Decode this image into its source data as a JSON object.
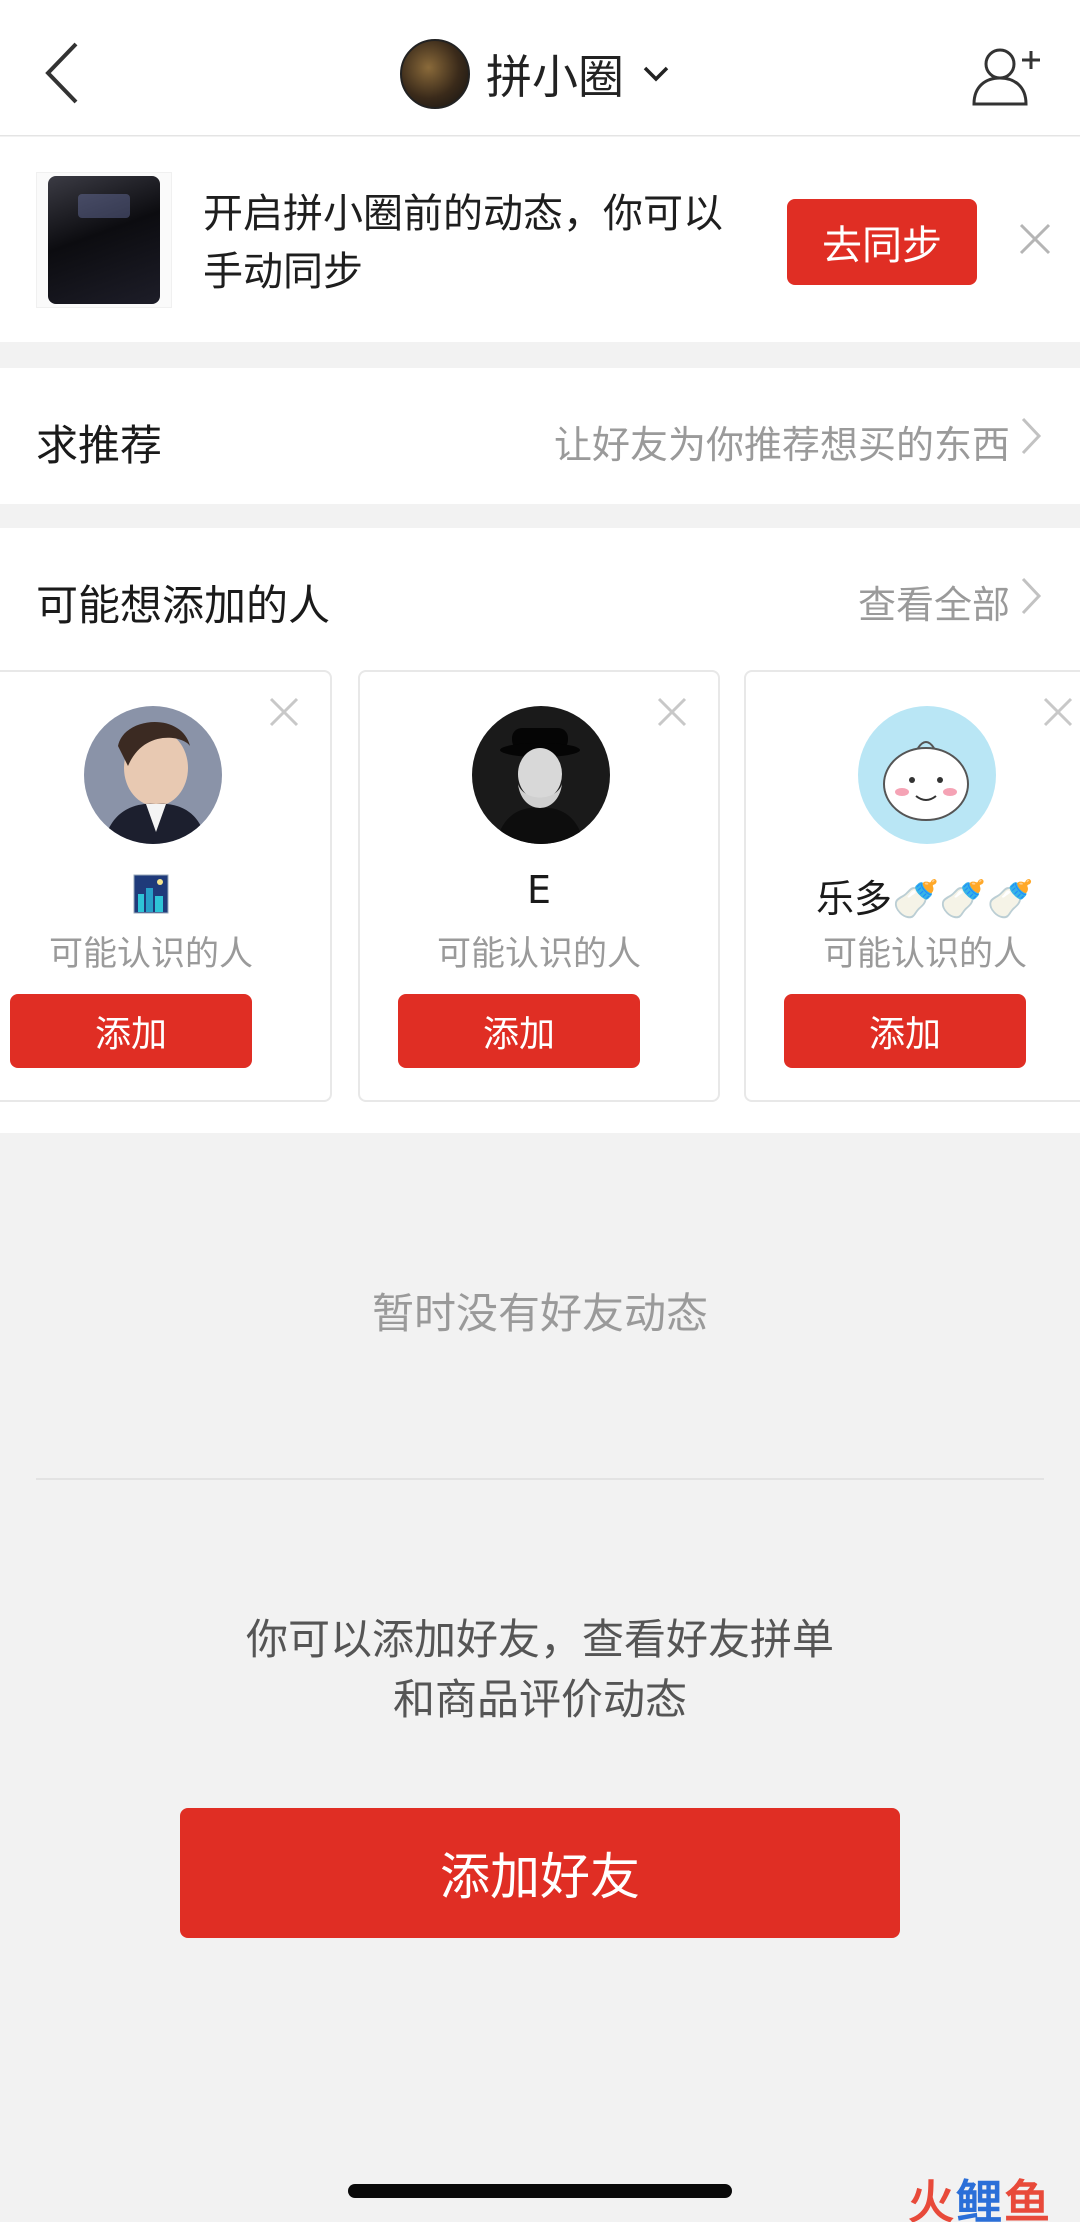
{
  "header": {
    "title": "拼小圈",
    "back_icon": "back-arrow-icon",
    "caret_icon": "chevron-down-icon",
    "add_friend_icon": "add-person-icon"
  },
  "sync_banner": {
    "text": "开启拼小圈前的动态，你可以手动同步",
    "button_label": "去同步",
    "close_icon": "close-icon",
    "accent": "#e02e24"
  },
  "recommend": {
    "title": "求推荐",
    "subtitle": "让好友为你推荐想买的东西"
  },
  "suggestions": {
    "title": "可能想添加的人",
    "view_all": "查看全部",
    "cards": [
      {
        "name": "",
        "name_icon": "night-city-emoji-icon",
        "subtitle": "可能认识的人",
        "button": "添加"
      },
      {
        "name": "E",
        "subtitle": "可能认识的人",
        "button": "添加"
      },
      {
        "name": "乐多🍼🍼🍼",
        "subtitle": "可能认识的人",
        "button": "添加"
      }
    ]
  },
  "empty_state": {
    "message": "暂时没有好友动态",
    "hint_line1": "你可以添加好友，查看好友拼单",
    "hint_line2": "和商品评价动态",
    "button_label": "添加好友"
  },
  "watermark": {
    "part1": "火",
    "part2": "鲤",
    "part3": "鱼"
  }
}
